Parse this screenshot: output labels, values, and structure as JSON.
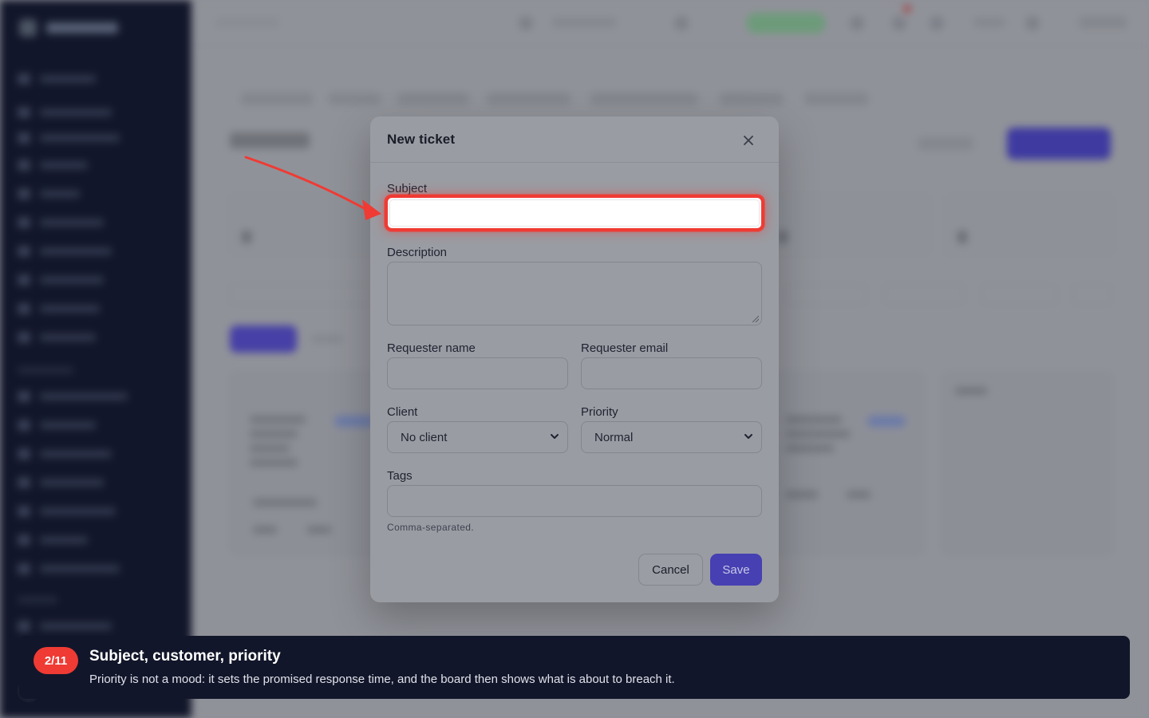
{
  "modal": {
    "title": "New ticket",
    "close_icon": "close-icon",
    "subject_label": "Subject",
    "subject_value": "",
    "description_label": "Description",
    "description_value": "",
    "requester_name_label": "Requester name",
    "requester_name_value": "",
    "requester_email_label": "Requester email",
    "requester_email_value": "",
    "client_label": "Client",
    "client_selected": "No client",
    "priority_label": "Priority",
    "priority_selected": "Normal",
    "tags_label": "Tags",
    "tags_value": "",
    "tags_hint": "Comma-separated.",
    "cancel_label": "Cancel",
    "save_label": "Save"
  },
  "tour": {
    "step": "2/11",
    "title": "Subject, customer, priority",
    "body": "Priority is not a mood: it sets the promised response time, and the board then shows what is about to breach it."
  },
  "colors": {
    "highlight": "#ef3b34",
    "primary": "#4640b2",
    "sidebar": "#12162a",
    "banner": "#12162a"
  }
}
